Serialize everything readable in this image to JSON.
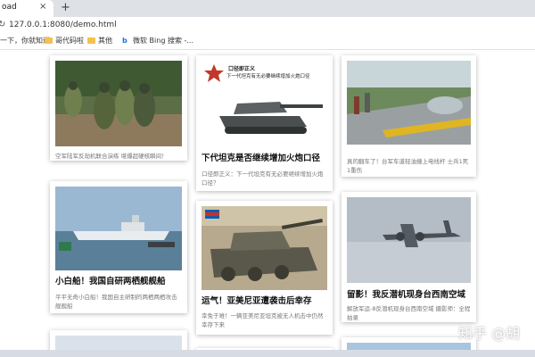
{
  "browser": {
    "tab_title": "oad",
    "tab_close": "×",
    "new_tab": "+",
    "url": "127.0.0.1:8080/demo.html",
    "bookmarks": [
      {
        "label": "一下，你就知道",
        "icon": "none"
      },
      {
        "label": "哥代码啦",
        "icon": "folder-icon"
      },
      {
        "label": "其他",
        "icon": "folder-icon"
      },
      {
        "label": "微软 Bing 搜索 -...",
        "icon": "bing-icon"
      }
    ]
  },
  "cards": [
    {
      "title": "",
      "desc": "空军陆军反劫机联合演练 堪爆超硬核瞬间！"
    },
    {
      "title": "下代坦克是否继续增加火炮口径",
      "desc": "口径即正义：下一代坦克有无必要继续增加火炮口径？",
      "overlay_title": "口径即正义",
      "overlay_sub": "下一代坦克有无必要继续增加火炮口径"
    },
    {
      "title": "",
      "desc": "真的翻车了！台军车道轻油撞上电线杆 士兵1死1重伤"
    },
    {
      "title": "小白船！我国自研两栖舰舰船",
      "desc": "平平无奇小白船！我国自主研制的两栖两栖攻击舰舰船"
    },
    {
      "title": "运气！亚美尼亚遭袭击后幸存",
      "desc": "幸免于难！一辆亚美尼亚坦克被无人机击中仍然幸存下来"
    },
    {
      "title": "留影！我反潜机现身台西南空域",
      "desc": "解放军运-8反潜机现身台西南空域 摄影师：全程拍录"
    }
  ],
  "watermark": "知乎 @胡",
  "colors": {
    "sky": "#9bb8d3",
    "sea": "#5a7f99",
    "camo": "#6f7f4e",
    "tank": "#4a4e4f"
  }
}
